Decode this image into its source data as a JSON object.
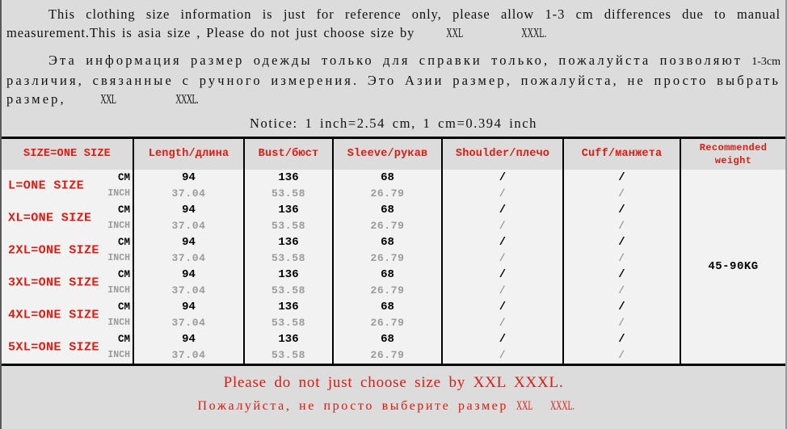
{
  "intro": {
    "english": "This clothing size information is just for reference only, please allow 1-3 cm differences due to manual measurement.This is asia size , Please do not just choose size by XXL XXXL.",
    "russian": "Эта информация размер одежды только для справки только, пожалуйста позволяют 1-3cm различия, связанные с ручного измерения. Это Азии размер, пожалуйста, не просто выбрать размер, XXL XXXL."
  },
  "notice": "Notice: 1 inch=2.54 cm, 1 cm=0.394 inch",
  "table": {
    "headers": {
      "size": "SIZE=ONE SIZE",
      "length": "Length/длина",
      "bust": "Bust/бюст",
      "sleeve": "Sleeve/рукав",
      "shoulder": "Shoulder/плечо",
      "cuff": "Cuff/манжета",
      "weight": "Recommended weight"
    },
    "unit_labels": {
      "cm": "CM",
      "inch": "INCH"
    },
    "recommended_weight": "45-90KG",
    "rows": [
      {
        "size": "L=ONE SIZE",
        "length_cm": "94",
        "length_inch": "37.04",
        "bust_cm": "136",
        "bust_inch": "53.58",
        "sleeve_cm": "68",
        "sleeve_inch": "26.79",
        "shoulder_cm": "/",
        "shoulder_inch": "/",
        "cuff_cm": "/",
        "cuff_inch": "/"
      },
      {
        "size": "XL=ONE SIZE",
        "length_cm": "94",
        "length_inch": "37.04",
        "bust_cm": "136",
        "bust_inch": "53.58",
        "sleeve_cm": "68",
        "sleeve_inch": "26.79",
        "shoulder_cm": "/",
        "shoulder_inch": "/",
        "cuff_cm": "/",
        "cuff_inch": "/"
      },
      {
        "size": "2XL=ONE SIZE",
        "length_cm": "94",
        "length_inch": "37.04",
        "bust_cm": "136",
        "bust_inch": "53.58",
        "sleeve_cm": "68",
        "sleeve_inch": "26.79",
        "shoulder_cm": "/",
        "shoulder_inch": "/",
        "cuff_cm": "/",
        "cuff_inch": "/"
      },
      {
        "size": "3XL=ONE SIZE",
        "length_cm": "94",
        "length_inch": "37.04",
        "bust_cm": "136",
        "bust_inch": "53.58",
        "sleeve_cm": "68",
        "sleeve_inch": "26.79",
        "shoulder_cm": "/",
        "shoulder_inch": "/",
        "cuff_cm": "/",
        "cuff_inch": "/"
      },
      {
        "size": "4XL=ONE SIZE",
        "length_cm": "94",
        "length_inch": "37.04",
        "bust_cm": "136",
        "bust_inch": "53.58",
        "sleeve_cm": "68",
        "sleeve_inch": "26.79",
        "shoulder_cm": "/",
        "shoulder_inch": "/",
        "cuff_cm": "/",
        "cuff_inch": "/"
      },
      {
        "size": "5XL=ONE SIZE",
        "length_cm": "94",
        "length_inch": "37.04",
        "bust_cm": "136",
        "bust_inch": "53.58",
        "sleeve_cm": "68",
        "sleeve_inch": "26.79",
        "shoulder_cm": "/",
        "shoulder_inch": "/",
        "cuff_cm": "/",
        "cuff_inch": "/"
      }
    ]
  },
  "footer": {
    "english": "Please do not just choose size by XXL XXXL.",
    "russian": "Пожалуйста, не просто выберите размер XXL XXXL."
  },
  "colors": {
    "accent_red": "#e01b12",
    "header_bg": "#dcdcdc",
    "body_bg": "#f2f2f2",
    "cm_text": "#000000",
    "inch_text": "#9b9b9b"
  }
}
